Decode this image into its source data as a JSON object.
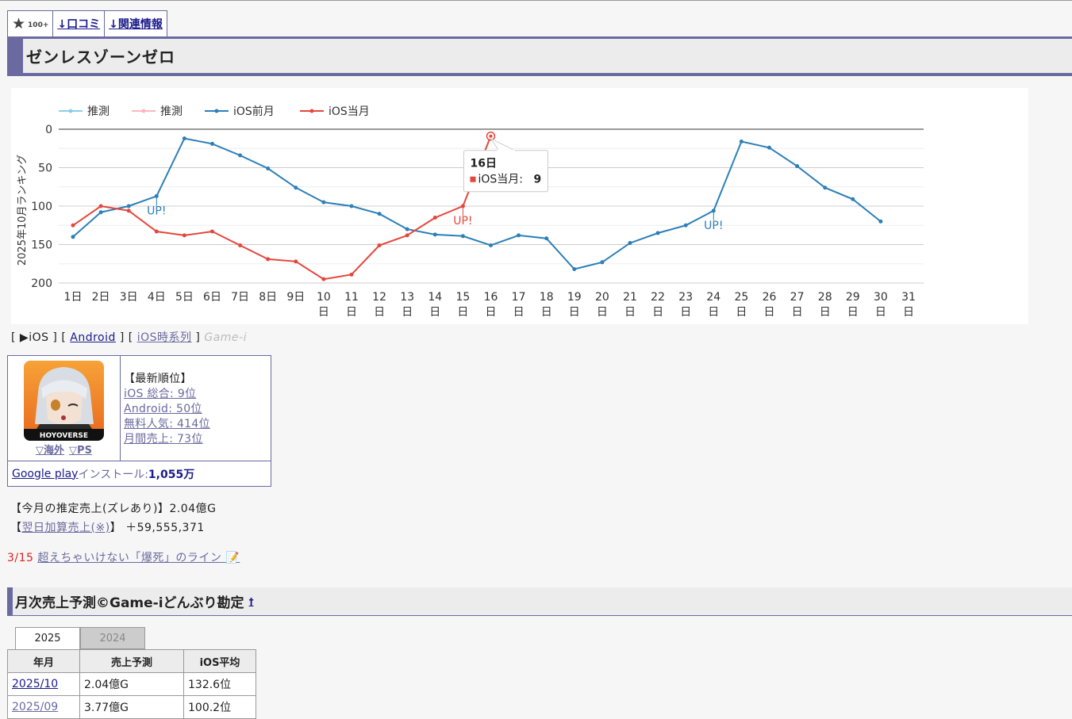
{
  "nav": {
    "favorite_count": "100+",
    "review_link": "↓口コミ",
    "related_link": "↓関連情報"
  },
  "app": {
    "title": "ゼンレスゾーンゼロ"
  },
  "chart_data": {
    "type": "line",
    "ylabel": "2025年10月ランキング",
    "ylim": [
      0,
      200
    ],
    "yticks": [
      0,
      50,
      100,
      150,
      200
    ],
    "y_inverted": true,
    "grid": true,
    "legend": [
      {
        "name": "推測",
        "color": "#87ceeb"
      },
      {
        "name": "推測",
        "color": "#ffb6c1"
      },
      {
        "name": "iOS前月",
        "color": "#2c7fb8"
      },
      {
        "name": "iOS当月",
        "color": "#e5463c"
      }
    ],
    "legend_position": "top-left",
    "x_labels": [
      "1日",
      "2日",
      "3日",
      "4日",
      "5日",
      "6日",
      "7日",
      "8日",
      "9日",
      "10日",
      "11日",
      "12日",
      "13日",
      "14日",
      "15日",
      "16日",
      "17日",
      "18日",
      "19日",
      "20日",
      "21日",
      "22日",
      "23日",
      "24日",
      "25日",
      "26日",
      "27日",
      "28日",
      "29日",
      "30日",
      "31日"
    ],
    "series": [
      {
        "name": "iOS前月",
        "color": "#2c7fb8",
        "values": [
          140,
          108,
          100,
          87,
          12,
          19,
          34,
          51,
          76,
          95,
          100,
          110,
          130,
          137,
          139,
          151,
          138,
          142,
          182,
          173,
          148,
          135,
          125,
          106,
          16,
          24,
          48,
          76,
          91,
          120,
          null
        ]
      },
      {
        "name": "iOS当月",
        "color": "#e5463c",
        "values": [
          125,
          100,
          106,
          133,
          138,
          133,
          151,
          169,
          172,
          195,
          189,
          151,
          138,
          115,
          100,
          9,
          null,
          null,
          null,
          null,
          null,
          null,
          null,
          null,
          null,
          null,
          null,
          null,
          null,
          null,
          null
        ]
      }
    ],
    "annotations": [
      {
        "day": 4,
        "text": "UP!",
        "series": "iOS前月"
      },
      {
        "day": 15,
        "text": "UP!",
        "series": "iOS当月"
      },
      {
        "day": 24,
        "text": "UP!",
        "series": "iOS前月"
      }
    ],
    "tooltip": {
      "day": "16日",
      "series": "iOS当月",
      "label": "iOS当月: ",
      "value": "9"
    }
  },
  "platforms": {
    "ios": "▶iOS",
    "android": "Android",
    "ios_timeline": "iOS時系列",
    "gamei": "Game-i"
  },
  "info": {
    "overseas_link": "▽海外",
    "ps_link": "▽PS",
    "latest_heading": "【最新順位】",
    "ranks": [
      "iOS 総合: 9位",
      "Android: 50位",
      "無料人気: 414位",
      "月間売上: 73位"
    ],
    "install_prefix": "Google play",
    "install_mid": "インストール: ",
    "install_count": "1,055万"
  },
  "estimates": {
    "monthly_label": "【今月の推定売上(ズレあり)】",
    "monthly_value": "2.04億G",
    "nextday_open": "【",
    "nextday_link": "翌日加算売上(※)",
    "nextday_close": "】",
    "nextday_value": "＋59,555,371"
  },
  "death_line": {
    "ratio": "3/15",
    "text": "超えちゃいけない「爆死」のライン"
  },
  "section2": {
    "title": "月次売上予測©Game-iどんぶり勘定",
    "sup": "†",
    "year_tabs": [
      "2025",
      "2024"
    ],
    "headers": [
      "年月",
      "売上予測",
      "iOS平均"
    ],
    "rows": [
      [
        "2025/10",
        "2.04億G",
        "132.6位"
      ],
      [
        "2025/09",
        "3.77億G",
        "100.2位"
      ]
    ]
  },
  "colors": {
    "accent": "#6a6aa0",
    "link": "#1a1a8c",
    "ios_prev": "#2c7fb8",
    "ios_current": "#e5463c"
  }
}
